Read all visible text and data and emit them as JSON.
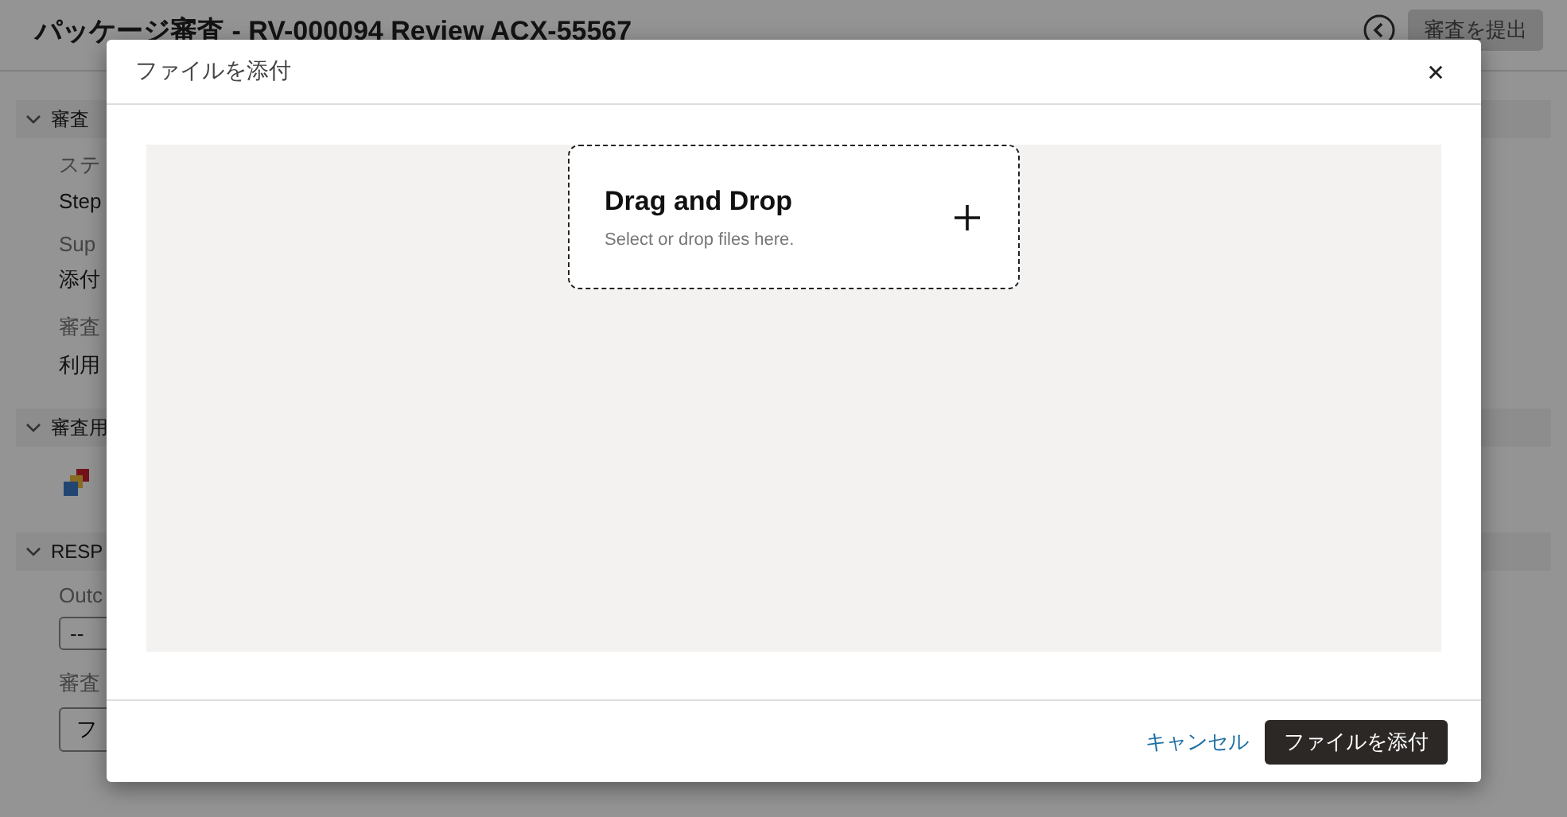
{
  "page": {
    "title": "パッケージ審査 - RV-000094 Review ACX-55567",
    "submit_button": {
      "label": "審査を提出",
      "disabled": true
    },
    "sections": [
      {
        "title": "審査",
        "expanded": true,
        "kind": "fields",
        "fields": [
          {
            "label": "ステ",
            "value": "Step"
          },
          {
            "label": "Sup",
            "value": "添付"
          },
          {
            "label": "審査",
            "value": "利用"
          }
        ]
      },
      {
        "title": "審査用",
        "expanded": true,
        "kind": "icon"
      },
      {
        "title": "RESP",
        "expanded": true,
        "kind": "form",
        "items": [
          {
            "label": "Outc",
            "control": {
              "kind": "select",
              "text": "--"
            }
          },
          {
            "label": "審査",
            "control": {
              "kind": "button",
              "text": "フ"
            }
          }
        ]
      }
    ]
  },
  "dialog": {
    "title": "ファイルを添付",
    "dropzone": {
      "title": "Drag and Drop",
      "hint": "Select or drop files here."
    },
    "buttons": [
      {
        "label": "キャンセル",
        "kind": "link"
      },
      {
        "label": "ファイルを添付",
        "kind": "primary"
      }
    ]
  }
}
